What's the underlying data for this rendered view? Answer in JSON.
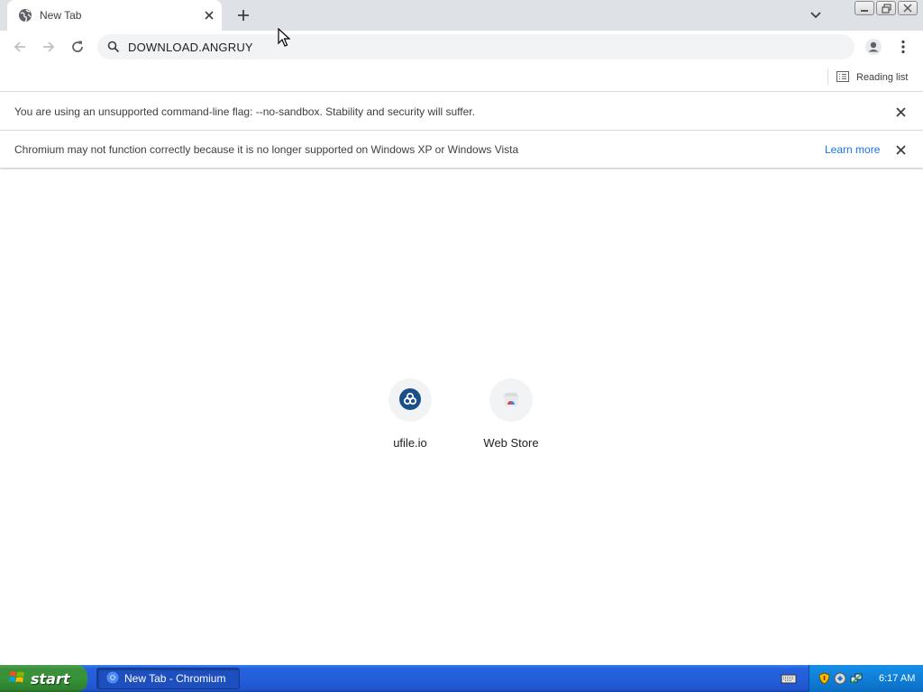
{
  "browser": {
    "tab": {
      "title": "New Tab",
      "favicon": "globe-icon"
    },
    "new_tab_icon": "plus-icon",
    "omnibox": {
      "value": "DOWNLOAD.ANGRUY",
      "icon": "search-icon"
    },
    "bookmarks": {
      "reading_list_label": "Reading list"
    },
    "infobars": [
      {
        "text": "You are using an unsupported command-line flag: --no-sandbox. Stability and security will suffer."
      },
      {
        "text": "Chromium may not function correctly because it is no longer supported on Windows XP or Windows Vista",
        "link": "Learn more"
      }
    ],
    "shortcuts": [
      {
        "label": "ufile.io",
        "icon": "ufile-icon",
        "color": "#1a4f8a"
      },
      {
        "label": "Web Store",
        "icon": "webstore-icon",
        "color": "#4285f4"
      }
    ],
    "colors": {
      "tabstrip": "#dee1e6",
      "link": "#1a73e8"
    }
  },
  "taskbar": {
    "start_label": "start",
    "task_button_label": "New Tab - Chromium",
    "clock": "6:17 AM"
  }
}
